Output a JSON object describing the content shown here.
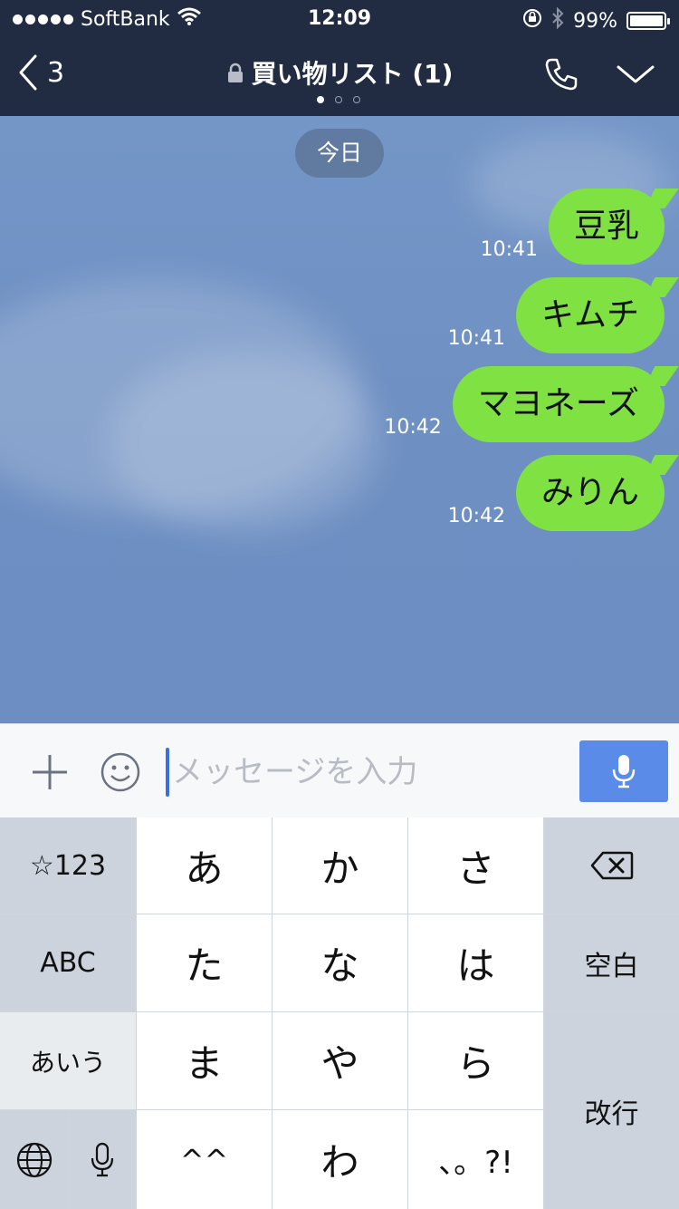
{
  "status_bar": {
    "carrier": "SoftBank",
    "time": "12:09",
    "battery": "99%",
    "battery_level": 0.99
  },
  "nav": {
    "back_count": "3",
    "title": "買い物リスト (1)",
    "pager_count": 3,
    "pager_active": 0
  },
  "chat": {
    "date_label": "今日",
    "messages": [
      {
        "text": "豆乳",
        "time": "10:41"
      },
      {
        "text": "キムチ",
        "time": "10:41"
      },
      {
        "text": "マヨネーズ",
        "time": "10:42"
      },
      {
        "text": "みりん",
        "time": "10:42"
      }
    ]
  },
  "input": {
    "placeholder": "メッセージを入力",
    "value": ""
  },
  "keyboard": {
    "symbols": "☆123",
    "abc": "ABC",
    "aiu": "あいう",
    "chars": [
      "あ",
      "か",
      "さ",
      "た",
      "な",
      "は",
      "ま",
      "や",
      "ら",
      "^^",
      "わ",
      "、。?!"
    ],
    "space": "空白",
    "enter": "改行"
  },
  "colors": {
    "header_bg": "#212c43",
    "chat_bg": "#7094c5",
    "bubble": "#80e142",
    "accent_blue": "#5b8be8"
  },
  "icons": [
    "back-chevron-icon",
    "lock-icon",
    "phone-icon",
    "chevron-down-icon",
    "plus-icon",
    "emoji-icon",
    "microphone-icon",
    "backspace-icon",
    "globe-icon",
    "wifi-icon",
    "orientation-lock-icon",
    "bluetooth-icon"
  ]
}
